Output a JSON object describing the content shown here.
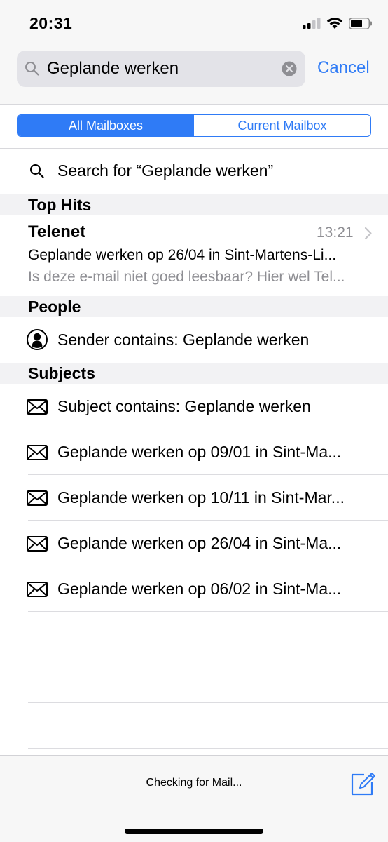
{
  "status_bar": {
    "time": "20:31"
  },
  "search": {
    "query": "Geplande werken",
    "cancel_label": "Cancel"
  },
  "scope": {
    "options": [
      "All Mailboxes",
      "Current Mailbox"
    ],
    "selected": "All Mailboxes"
  },
  "suggestion": {
    "label": "Search for “Geplande werken”"
  },
  "sections": {
    "top_hits": {
      "title": "Top Hits",
      "hit": {
        "sender": "Telenet",
        "time": "13:21",
        "subject": "Geplande werken op 26/04 in Sint-Martens-Li...",
        "preview": "Is deze e-mail niet goed leesbaar? Hier wel Tel..."
      }
    },
    "people": {
      "title": "People",
      "items": [
        "Sender contains: Geplande werken"
      ]
    },
    "subjects": {
      "title": "Subjects",
      "items": [
        "Subject contains: Geplande werken",
        "Geplande werken op 09/01 in Sint-Ma...",
        "Geplande werken op 10/11 in Sint-Mar...",
        "Geplande werken op 26/04 in Sint-Ma...",
        "Geplande werken op 06/02 in Sint-Ma..."
      ]
    }
  },
  "bottom_bar": {
    "status": "Checking for Mail..."
  },
  "colors": {
    "accent": "#2f7bf6",
    "secondary_text": "#8e8e93"
  },
  "icons": [
    "signal-icon",
    "wifi-icon",
    "battery-icon",
    "search-icon",
    "clear-icon",
    "person-icon",
    "envelope-icon",
    "chevron-right-icon",
    "compose-icon"
  ]
}
